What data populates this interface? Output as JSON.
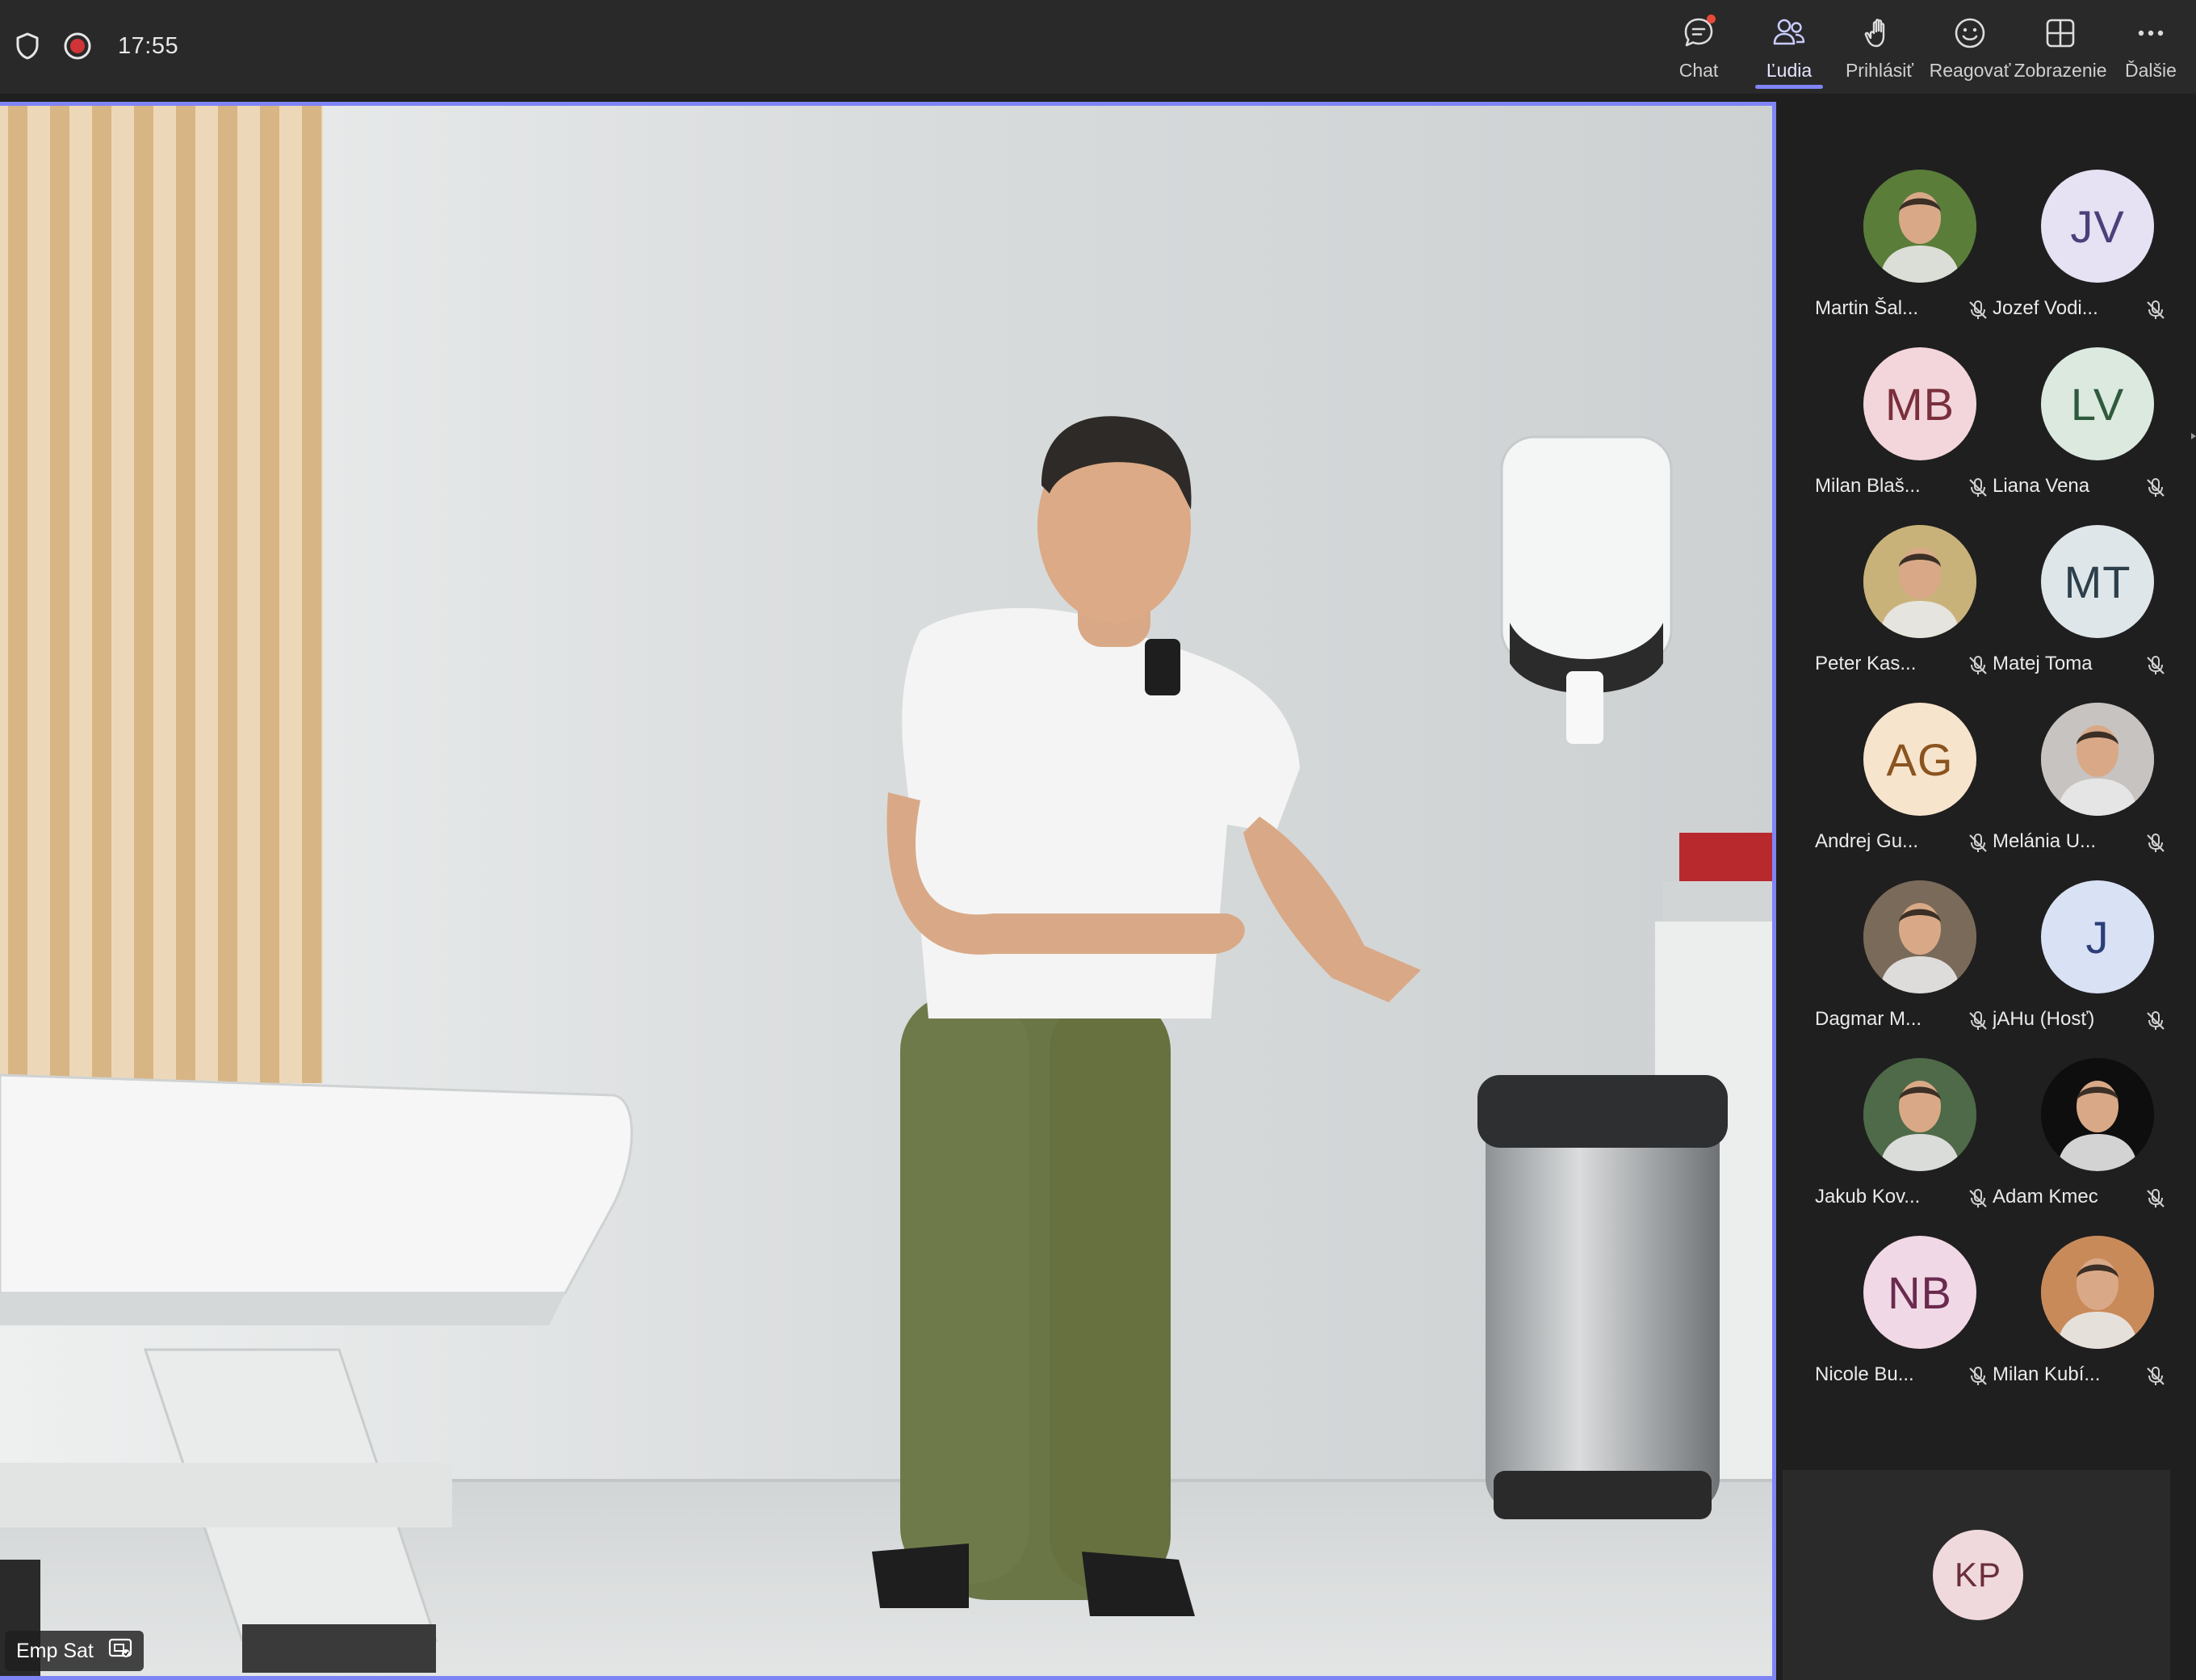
{
  "topbar": {
    "time": "17:55",
    "actions": [
      {
        "id": "chat",
        "label": "Chat",
        "icon": "chat-icon",
        "notify": true
      },
      {
        "id": "people",
        "label": "Ľudia",
        "icon": "people-icon",
        "active": true
      },
      {
        "id": "raise",
        "label": "Prihlásiť",
        "icon": "raise-hand-icon"
      },
      {
        "id": "react",
        "label": "Reagovať",
        "icon": "smiley-icon"
      },
      {
        "id": "view",
        "label": "Zobrazenie",
        "icon": "grid-view-icon"
      },
      {
        "id": "more",
        "label": "Ďalšie",
        "icon": "more-icon"
      }
    ]
  },
  "stage": {
    "speaker_name": "Emp Sat"
  },
  "participants": [
    {
      "name": "Martin Šal...",
      "initials": "",
      "photo": true,
      "bg": "#5a7d3a",
      "fg": "#ffffff"
    },
    {
      "name": "Jozef Vodi...",
      "initials": "JV",
      "bg": "#e6e1f3",
      "fg": "#4c3f7a"
    },
    {
      "name": "Milan Blaš...",
      "initials": "MB",
      "bg": "#f3d6db",
      "fg": "#7a2f3c"
    },
    {
      "name": "Liana Vena",
      "initials": "LV",
      "bg": "#dbe9df",
      "fg": "#2f5a3c"
    },
    {
      "name": "Peter Kas...",
      "initials": "",
      "photo": true,
      "bg": "#c9b27a",
      "fg": "#ffffff"
    },
    {
      "name": "Matej Toma",
      "initials": "MT",
      "bg": "#dfe6ea",
      "fg": "#2c3f4a"
    },
    {
      "name": "Andrej Gu...",
      "initials": "AG",
      "bg": "#f7e4cc",
      "fg": "#8a5420"
    },
    {
      "name": "Melánia U...",
      "initials": "",
      "photo": true,
      "bg": "#c7c3c0",
      "fg": "#ffffff"
    },
    {
      "name": "Dagmar M...",
      "initials": "",
      "photo": true,
      "bg": "#7a6a5a",
      "fg": "#ffffff"
    },
    {
      "name": "jAHu (Hosť)",
      "initials": "J",
      "bg": "#d9e2f5",
      "fg": "#2c3f7a"
    },
    {
      "name": "Jakub Kov...",
      "initials": "",
      "photo": true,
      "bg": "#4e6a48",
      "fg": "#ffffff"
    },
    {
      "name": "Adam Kmec",
      "initials": "",
      "photo": true,
      "bg": "#0e0e0e",
      "fg": "#ffffff"
    },
    {
      "name": "Nicole Bu...",
      "initials": "NB",
      "bg": "#f1d8e6",
      "fg": "#6a2a4e"
    },
    {
      "name": "Milan Kubí...",
      "initials": "",
      "photo": true,
      "bg": "#c98a5a",
      "fg": "#ffffff"
    }
  ],
  "overflow": {
    "initials": "KP",
    "bg": "#f0d9dc",
    "fg": "#6a2f3a"
  }
}
